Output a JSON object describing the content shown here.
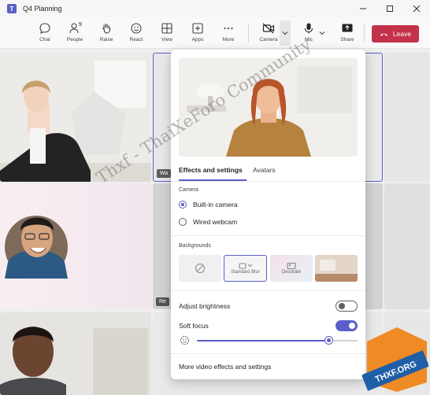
{
  "window": {
    "title": "Q4 Planning"
  },
  "toolbar": {
    "chat": "Chat",
    "people": "People",
    "people_count": "9",
    "raise": "Raise",
    "react": "React",
    "view": "View",
    "apps": "Apps",
    "more": "More",
    "camera": "Camera",
    "mic": "Mic",
    "share": "Share",
    "leave": "Leave"
  },
  "tiles": {
    "label_truncated_1": "Wa",
    "label_truncated_2": "Re"
  },
  "popup": {
    "tabs": [
      "Effects and settings",
      "Avatars"
    ],
    "active_tab": 0,
    "camera_section": "Camera",
    "camera_options": [
      "Built-in camera",
      "Wired webcam"
    ],
    "camera_selected": 0,
    "backgrounds_section": "Backgrounds",
    "backgrounds": [
      "None",
      "Standard Blur",
      "Decorate",
      "Image"
    ],
    "backgrounds_selected": 1,
    "adjust_brightness": {
      "label": "Adjust brightness",
      "on": false
    },
    "soft_focus": {
      "label": "Soft focus",
      "on": true,
      "level": 0.82
    },
    "more_link": "More video effects and settings"
  },
  "watermark": {
    "text": "Thxf - ThaiXeForo Community",
    "badge": "THXF.ORG"
  },
  "colors": {
    "accent": "#5b5fc7",
    "leave": "#c4314b",
    "badge_orange": "#f08a24",
    "badge_blue": "#1f5fa8"
  }
}
